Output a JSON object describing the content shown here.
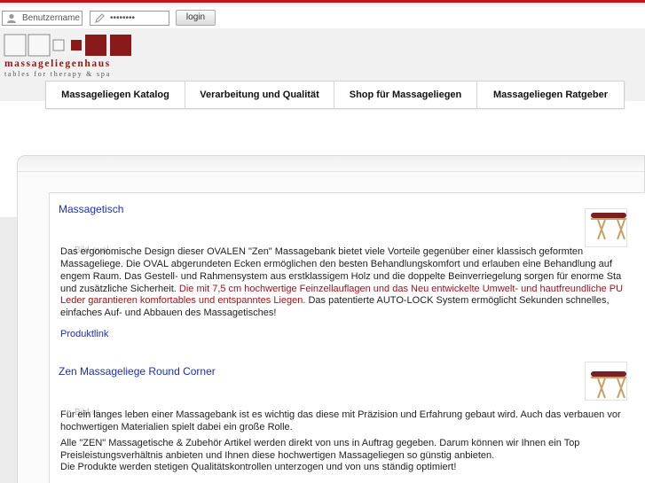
{
  "login": {
    "username_placeholder": "Benutzername",
    "password_value": "••••••••",
    "button_label": "login"
  },
  "logo": {
    "title": "massageliegenhaus",
    "subtitle": "tables for therapy & spa"
  },
  "nav": {
    "items": [
      {
        "label": "Massageliegen Katalog"
      },
      {
        "label": "Verarbeitung und Qualität"
      },
      {
        "label": "Shop für Massageliegen"
      },
      {
        "label": "Massageliegen Ratgeber"
      }
    ]
  },
  "articles": [
    {
      "title": "Massagetisch",
      "ghost": "Bild-oval",
      "lines": [
        "Das ergonomische Design dieser OVALEN \"Zen\" Massagebank bietet viele Vorteile gegenüber einer klassisch geformten",
        "Massageliege. Die OVAL abgerundeten Ecken ermöglichen den besten Behandlungskomfort und erlauben eine Behandlung auf",
        "engem Raum. Das Gestell- und Rahmensystem aus erstklassigem Holz und die doppelte Beinverriegelung sorgen für enorme Sta",
        "und zusätzliche Sicherheit. "
      ],
      "highlight_a": "Die mit 7,5 cm hochwertige Feinzellauflagen und das Neu entwickelte Umwelt- und hautfreundliche PU",
      "highlight_b": "Leder garantieren komfortables und entspanntes Liegen.",
      "line5_tail": " Das patentierte AUTO-LOCK System ermöglicht Sekunden schnelles,",
      "line6": "einfaches Auf- und Abbauen des Massagetisches!",
      "link": "Produktlink"
    },
    {
      "title": "Zen Massageliege Round Corner",
      "ghost": "Bild-rc",
      "lines": [
        "Für ein langes leben einer Massagebank ist es wichtig das diese mit Präzision und Erfahrung gebaut wird. Auch das verbauen vor",
        "hochwertigen Materialien spielt dabei ein große Rolle.",
        "Alle \"ZEN\" Massagetische & Zubehör Artikel werden direkt von uns in Auftrag gegeben. Darum können wir Ihnen ein Top",
        "Preisleistungsverhältnis anbieten und Ihnen diese hochwertigen Massageliegen so günstig anbieten.",
        "Die Produkte werden stetigen Qualitätskontrollen unterzogen und von uns ständig optimiert!"
      ]
    }
  ],
  "colors": {
    "brand_red": "#c0141c",
    "logo_red": "#8a1a1a",
    "link_blue": "#1d2fb8",
    "highlight_red": "#a4111a"
  }
}
